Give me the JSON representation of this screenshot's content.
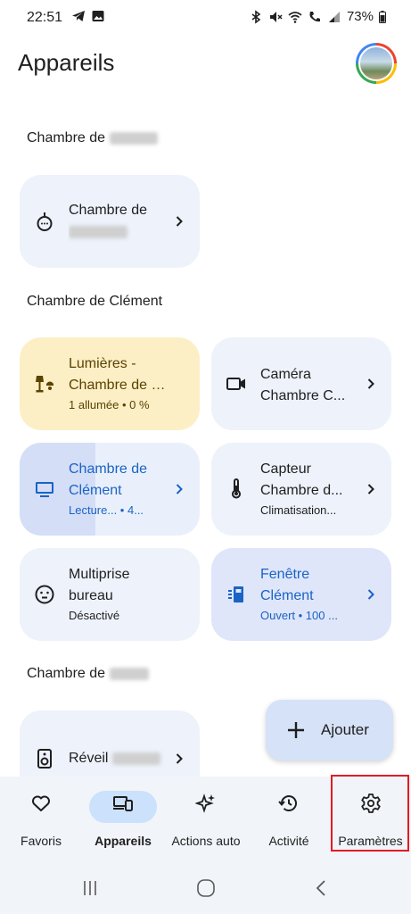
{
  "status_bar": {
    "time": "22:51",
    "left_icons": [
      "telegram-icon",
      "image-icon"
    ],
    "right_icons": [
      "bluetooth-icon",
      "mute-icon",
      "wifi-icon",
      "call-icon",
      "signal-icon"
    ],
    "battery": "73%"
  },
  "header": {
    "title": "Appareils",
    "avatar": "avatar"
  },
  "sections": [
    {
      "title": "Chambre de",
      "tiles": [
        {
          "line1": "Chambre de",
          "line2": "",
          "sub": "",
          "icon": "hub-icon"
        }
      ]
    },
    {
      "title": "Chambre de Clément",
      "tiles": [
        {
          "line1": "Lumières -",
          "line2": "Chambre de Cl...",
          "sub": "1 allumée • 0 %",
          "icon": "lamp-icon"
        },
        {
          "line1": "Caméra",
          "line2": "Chambre C...",
          "sub": "",
          "icon": "camera-icon"
        },
        {
          "line1": "Chambre de",
          "line2": "Clément",
          "sub": "Lecture... • 4...",
          "icon": "tv-icon"
        },
        {
          "line1": "Capteur",
          "line2": "Chambre d...",
          "sub": "Climatisation...",
          "icon": "thermometer-icon"
        },
        {
          "line1": "Multiprise",
          "line2": "bureau",
          "sub": "Désactivé",
          "icon": "plug-icon"
        },
        {
          "line1": "Fenêtre",
          "line2": "Clément",
          "sub": "Ouvert • 100 ...",
          "icon": "window-sensor-icon"
        }
      ]
    },
    {
      "title": "Chambre de",
      "tiles": [
        {
          "line1": "Réveil",
          "line2": "",
          "sub": "",
          "icon": "speaker-icon"
        }
      ]
    }
  ],
  "fab": {
    "label": "Ajouter"
  },
  "bottom_nav": [
    {
      "label": "Favoris",
      "icon": "heart-icon"
    },
    {
      "label": "Appareils",
      "icon": "devices-icon",
      "active": true
    },
    {
      "label": "Actions auto",
      "icon": "sparkle-icon"
    },
    {
      "label": "Activité",
      "icon": "history-icon"
    },
    {
      "label": "Paramètres",
      "icon": "gear-icon"
    }
  ],
  "colors": {
    "accent": "#1a63c4",
    "highlight": "#e01b24",
    "tile": "#edf2fb",
    "tile_on": "#fcefc6"
  }
}
